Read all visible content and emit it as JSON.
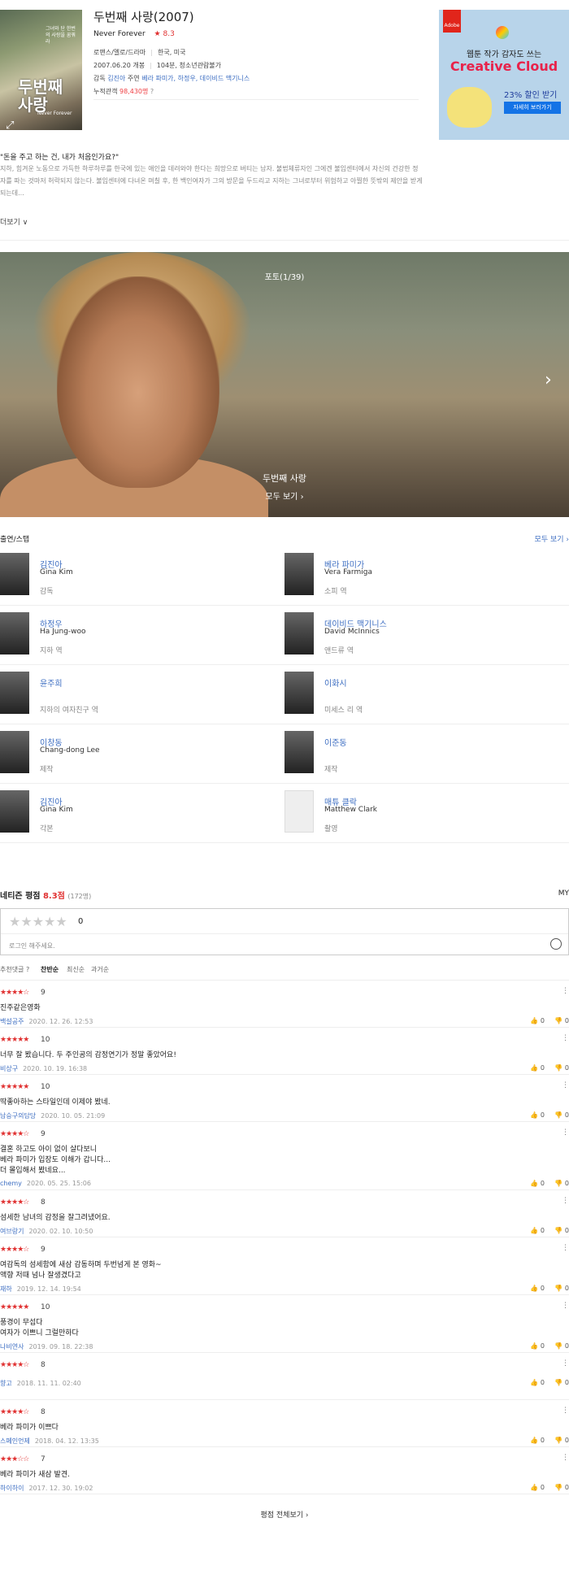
{
  "movie": {
    "title": "두번째 사랑(2007)",
    "title_en": "Never Forever",
    "rating": "★ 8.3",
    "genre": "로맨스/멜로/드라마",
    "country": "한국, 미국",
    "release": "2007.06.20 개봉",
    "runtime": "104분, 청소년관람불가",
    "director_label": "감독",
    "director": "김진아",
    "cast_label": "주연",
    "leads": "베라 파미가, 하정우, 데이비드 맥기니스",
    "audience_label": "누적관객",
    "audience": "98,430명",
    "audience_help": "?",
    "poster_text": "두번째 사랑",
    "poster_caption": "그녀와 단 한번의 사랑을 꿈꿔라",
    "poster_en": "Never Forever",
    "tagline": "\"돈을 주고 하는 건, 내가 처음인가요?\"",
    "synopsis": "지하, 힘겨운 노동으로 가득한 하루하루를 한국에 있는 애인을 데려와야 한다는 희망으로 버티는 남자. 불법체류자인 그에겐 불임센터에서 자신의 건강한 정자를 파는 것마저 허락되지 않는다. 불임센터에 다녀온 며칠 후, 한 백인여자가 그의 방문을 두드리고 지하는 그녀로부터 위험하고 아찔한 뜻밖의 제안을 받게 되는데...",
    "more": "더보기 ∨"
  },
  "ad": {
    "brand": "Adobe",
    "line1": "웹툰 작가 감자도 쓰는",
    "line2": "Creative Cloud",
    "discount": "23% 할인 받기",
    "button": "자세히 보러가기"
  },
  "photo": {
    "count": "포토(1/39)",
    "title": "두번째 사랑",
    "view_all": "모두 보기 ›",
    "next": "›"
  },
  "cast_section": {
    "heading": "출연/스탭",
    "view_all": "모두 보기 ›",
    "people": [
      {
        "ko": "김진아",
        "en": "Gina Kim",
        "role": "감독"
      },
      {
        "ko": "베라 파미가",
        "en": "Vera Farmiga",
        "role": "소피 역"
      },
      {
        "ko": "하정우",
        "en": "Ha Jung-woo",
        "role": "지하 역"
      },
      {
        "ko": "데이비드 맥기니스",
        "en": "David McInnics",
        "role": "앤드류 역"
      },
      {
        "ko": "윤주희",
        "en": "",
        "role": "지하의 여자친구 역"
      },
      {
        "ko": "이화시",
        "en": "",
        "role": "미세스 리 역"
      },
      {
        "ko": "이창동",
        "en": "Chang-dong Lee",
        "role": "제작"
      },
      {
        "ko": "이준동",
        "en": "",
        "role": "제작"
      },
      {
        "ko": "김진아",
        "en": "Gina Kim",
        "role": "각본"
      },
      {
        "ko": "매튜 클락",
        "en": "Matthew Clark",
        "role": "촬영"
      }
    ]
  },
  "reviews_section": {
    "heading": "네티즌 평점",
    "score": "8.3점",
    "count": "(172명)",
    "my": "MY",
    "input_stars": "★★★★★",
    "input_score": "0",
    "placeholder": "로그인 해주세요.",
    "sort_label": "추천댓글 ?",
    "sort": [
      "찬반순",
      "최신순",
      "과거순"
    ],
    "view_all": "평점 전체보기 ›",
    "items": [
      {
        "stars": "★★★★☆",
        "score": "9",
        "text": "진주같은영화",
        "author": "백설공주",
        "date": "2020. 12. 26. 12:53",
        "like": "0",
        "dislike": "0"
      },
      {
        "stars": "★★★★★",
        "score": "10",
        "text": "너무 잘 봤습니다. 두 주인공의 감정연기가 정말 좋았어요!",
        "author": "비상구",
        "date": "2020. 10. 19. 16:38",
        "like": "0",
        "dislike": "0"
      },
      {
        "stars": "★★★★★",
        "score": "10",
        "text": "딱좋아하는 스타일인데 이제야 봤네.",
        "author": "남승구의담당",
        "date": "2020. 10. 05. 21:09",
        "like": "0",
        "dislike": "0"
      },
      {
        "stars": "★★★★☆",
        "score": "9",
        "text": "결혼 하고도 아이 없이 살다보니\n베라 파미가 입장도 이해가 갑니다...\n더 몰입해서 봤네요...",
        "author": "chemy",
        "date": "2020. 05. 25. 15:06",
        "like": "0",
        "dislike": "0"
      },
      {
        "stars": "★★★★☆",
        "score": "8",
        "text": "섬세한 남녀의 감정을 잘그려냈어요.",
        "author": "여브랑기",
        "date": "2020. 02. 10. 10:50",
        "like": "0",
        "dislike": "0"
      },
      {
        "stars": "★★★★☆",
        "score": "9",
        "text": "여감독의 섬세함에 새삼 감동하며 두번넘게 본 영화~\n액향 저때 넘나 잘생겼다고",
        "author": "재하",
        "date": "2019. 12. 14. 19:54",
        "like": "0",
        "dislike": "0"
      },
      {
        "stars": "★★★★★",
        "score": "10",
        "text": "풍경이 무섭다\n여자가 이쁘니 그럴만하다",
        "author": "나비연사",
        "date": "2019. 09. 18. 22:38",
        "like": "0",
        "dislike": "0"
      },
      {
        "stars": "★★★★☆",
        "score": "8",
        "text": "",
        "author": "향고",
        "date": "2018. 11. 11. 02:40",
        "like": "0",
        "dislike": "0"
      },
      {
        "stars": "★★★★☆",
        "score": "8",
        "text": "베라 파미가 이쁘다",
        "author": "스페인언제",
        "date": "2018. 04. 12. 13:35",
        "like": "0",
        "dislike": "0"
      },
      {
        "stars": "★★★☆☆",
        "score": "7",
        "text": "베라 파미가 새삼 발견.",
        "author": "하이하이",
        "date": "2017. 12. 30. 19:02",
        "like": "0",
        "dislike": "0"
      }
    ]
  },
  "colors": {
    "accent": "#3d6ec2",
    "star": "#e03131"
  }
}
